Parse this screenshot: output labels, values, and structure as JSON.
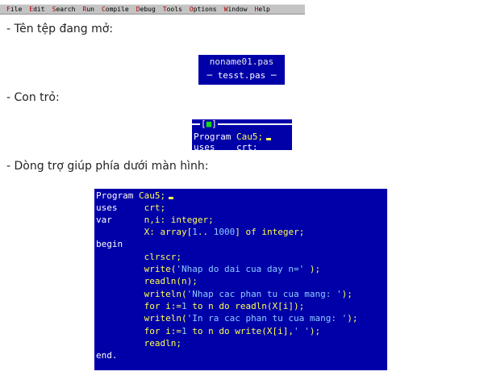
{
  "menubar": {
    "items": [
      {
        "hot": "F",
        "rest": "ile"
      },
      {
        "hot": "E",
        "rest": "dit"
      },
      {
        "hot": "S",
        "rest": "earch"
      },
      {
        "hot": "R",
        "rest": "un"
      },
      {
        "hot": "C",
        "rest": "ompile"
      },
      {
        "hot": "D",
        "rest": "ebug"
      },
      {
        "hot": "T",
        "rest": "ools"
      },
      {
        "hot": "O",
        "rest": "ptions"
      },
      {
        "hot": "W",
        "rest": "indow"
      },
      {
        "hot": "H",
        "rest": "elp"
      }
    ]
  },
  "captions": {
    "open_file": "- Tên tệp đang mở:",
    "cursor": "- Con trỏ:",
    "help_line": "- Dòng trợ giúp phía dưới màn hình:"
  },
  "window_list": {
    "item1": "noname01.pas",
    "item2": "tesst.pas",
    "dash_left": "─",
    "dash_right": "─"
  },
  "cursor_snippet": {
    "bracket_open": "[",
    "bracket_mark": "■",
    "bracket_close": "]",
    "keyword": "Program",
    "name": "Cau5;",
    "partial_next": "uses    crt;"
  },
  "code": {
    "l1a": "Program",
    "l1b": " Cau5;",
    "l2a": "uses",
    "l2b": "     crt;",
    "l3a": "var",
    "l3b": "      n,i: integer;",
    "l4a": "         X: array[",
    "l4n1": "1",
    "l4b": ".. ",
    "l4n2": "1000",
    "l4c": "] of integer;",
    "l5": "begin",
    "l6": "         clrscr;",
    "l7a": "         write(",
    "l7s": "'Nhap do dai cua day n='",
    "l7b": " );",
    "l8": "         readln(n);",
    "l9a": "         writeln(",
    "l9s": "'Nhap cac phan tu cua mang: '",
    "l9b": ");",
    "l10a": "         for i:=",
    "l10n": "1",
    "l10b": " to n do readln(X[i]);",
    "l11a": "         writeln(",
    "l11s": "'In ra cac phan tu cua mang: '",
    "l11b": ");",
    "l12a": "         for i:=",
    "l12n": "1",
    "l12b": " to n do write(X[i],",
    "l12s": "' '",
    "l12c": ");",
    "l13": "         readln;",
    "l14": "end."
  }
}
